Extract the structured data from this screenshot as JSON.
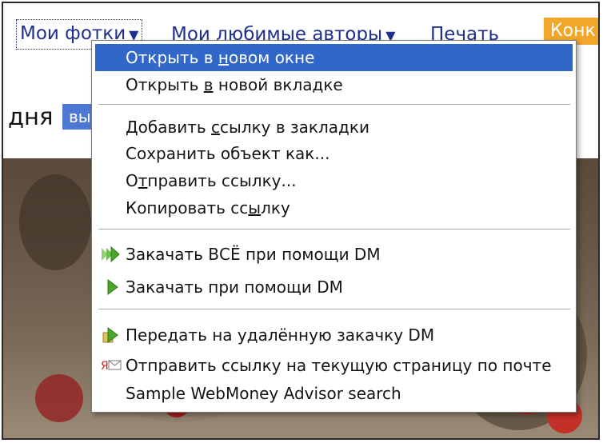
{
  "nav": {
    "my_photos": "Мои фотки",
    "fav_authors": "Мои любимые авторы",
    "print": "Печать",
    "contest": "Конк",
    "caret": "▼"
  },
  "page": {
    "heading_fragment": "дня",
    "chip_fragment": "вы"
  },
  "context_menu": {
    "items": [
      {
        "label": "Открыть в новом окне",
        "highlighted": true,
        "mnemonic": "н"
      },
      {
        "label": "Открыть в новой вкладке",
        "mnemonic": "в"
      },
      {
        "label": "Добавить ссылку в закладки",
        "mnemonic": "с"
      },
      {
        "label": "Сохранить объект как...",
        "mnemonic": "С"
      },
      {
        "label": "Отправить ссылку...",
        "mnemonic": "т"
      },
      {
        "label": "Копировать ссылку",
        "mnemonic": "ы"
      },
      {
        "label": "Закачать ВСЁ при помощи DM",
        "icon": "download-all-icon"
      },
      {
        "label": "Закачать при помощи DM",
        "icon": "download-icon"
      },
      {
        "label": "Передать на удалённую закачку DM",
        "icon": "remote-download-icon"
      },
      {
        "label": "Отправить ссылку на текущую страницу по почте",
        "icon": "yandex-mail-icon"
      },
      {
        "label": "Sample WebMoney Advisor search"
      }
    ]
  },
  "colors": {
    "highlight": "#3167c8",
    "link": "#1f2f8f",
    "contest_badge": "#f2a62a",
    "chip": "#4c78d4",
    "dm_green": "#4aa52a"
  }
}
